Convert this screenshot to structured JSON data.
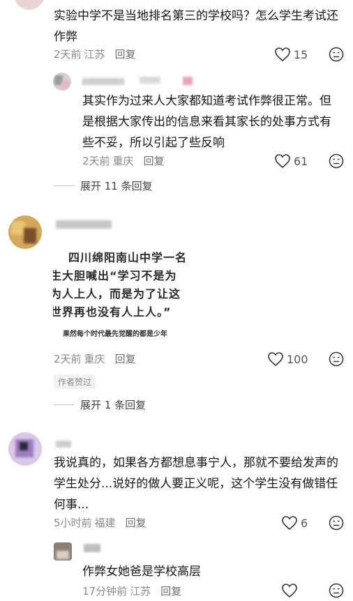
{
  "comments": [
    {
      "text_lines": [
        "实验中学不是当地排名第三的学校吗？怎么学生考试还",
        "作弊"
      ],
      "time": "2天前",
      "location": "江苏",
      "reply_label": "回复",
      "likes": "15"
    },
    {
      "text_lines": [
        "其实作为过来人大家都知道考试作弊很正常。但",
        "是根据大家传出的信息来看其家长的处事方式有",
        "些不妥，所以引起了些反响"
      ],
      "time": "2天前",
      "location": "重庆",
      "reply_label": "回复",
      "likes": "61",
      "expand_label": "展开 11 条回复"
    },
    {
      "image_lines": [
        "四川绵阳南山中学一名",
        "生大胆喊出“学习不是为",
        "为人上人，而是为了让这",
        "世界再也没有人上人。”"
      ],
      "image_caption": "果然每个时代最先觉醒的都是少年",
      "time": "2天前",
      "location": "重庆",
      "reply_label": "回复",
      "likes": "100",
      "author_badge": "作者赞过",
      "expand_label": "展开 1 条回复"
    },
    {
      "text_lines": [
        "我说真的，如果各方都想息事宁人，那就不要给发声的",
        "学生处分...说好的做人要正义呢，这个学生没有做错任",
        "何事..."
      ],
      "time": "5小时前",
      "location": "福建",
      "reply_label": "回复",
      "likes": "6"
    },
    {
      "text_lines": [
        "作弊女她爸是学校高层"
      ],
      "time": "17分钟前",
      "location": "江苏",
      "reply_label": "回复"
    }
  ],
  "icons": {
    "like": "heart-outline-icon",
    "dislike": "unhappy-face-icon"
  },
  "colors": {
    "meta": "#8a8a8a",
    "text": "#161616"
  }
}
